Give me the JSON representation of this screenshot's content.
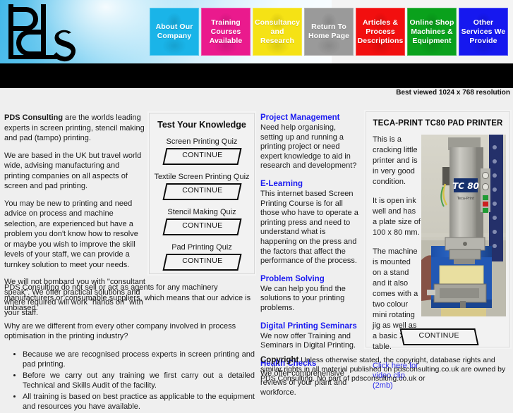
{
  "header": {
    "logo_text": "pds",
    "best_viewed": "Best viewed 1024 x 768 resolution",
    "nav": [
      {
        "label": "About Our Company",
        "color": "#1ab4e8",
        "class": "b-cyan",
        "name": "nav-about-our-company"
      },
      {
        "label": "Training Courses Available",
        "color": "#ea1a8d",
        "class": "b-magenta",
        "name": "nav-training-courses-available"
      },
      {
        "label": "Consultancy and Research",
        "color": "#f5e215",
        "class": "b-yellow",
        "name": "nav-consultancy-and-research"
      },
      {
        "label": "Return To Home Page",
        "color": "#9a9a9a",
        "class": "b-gray",
        "name": "nav-return-to-home-page"
      },
      {
        "label": "Articles & Process Descriptions",
        "color": "#f20f0f",
        "class": "b-red",
        "name": "nav-articles-process-descriptions"
      },
      {
        "label": "Online Shop Machines & Equipment",
        "color": "#0aa11c",
        "class": "b-green",
        "name": "nav-online-shop-machines-equipment"
      },
      {
        "label": "Other Services We Provide",
        "color": "#1618ef",
        "class": "b-blue",
        "name": "nav-other-services-we-provide"
      }
    ]
  },
  "left_column": {
    "lead_bold": "PDS Consulting",
    "p1_rest": " are the worlds leading experts in screen printing, stencil making and pad (tampo) printing.",
    "p2": "We are based in the UK but travel world wide, advising manufacturing and printing companies on all aspects of screen and pad printing.",
    "p3": "You may be new to printing and need advice on process and machine selection, are experienced but have a problem you don't know how to resolve or maybe you wish to improve the skill levels of your staff, we can provide a turnkey solution to meet your needs.",
    "p4": "We will not bombard you with \"consultant speak\". We offer practical solutions and where required will work \"hands on\" with your staff."
  },
  "lower_section": {
    "p1": "PDS Consulting do not sell or act as agents for any machinery manufacturers or consumable suppliers, which means that our advice is unbiased.",
    "p2": "Why are we different from every other company involved in process optimisation in the printing industry?",
    "bullets": [
      "Because we are recognised process experts in screen printing and pad printing.",
      "Before we carry out any training we first carry out a detailed Technical and Skills Audit of the facility.",
      "All training is based on best practice as applicable to the equipment and resources you have available."
    ]
  },
  "quiz_panel": {
    "title": "Test Your Knowledge",
    "continue_label": "CONTINUE",
    "items": [
      {
        "label": "Screen Printing Quiz",
        "name": "quiz-screen-printing"
      },
      {
        "label": "Textile Screen Printing Quiz",
        "name": "quiz-textile-screen-printing"
      },
      {
        "label": "Stencil Making Quiz",
        "name": "quiz-stencil-making"
      },
      {
        "label": "Pad Printing Quiz",
        "name": "quiz-pad-printing"
      }
    ]
  },
  "services": [
    {
      "heading": "Project Management",
      "body": "Need help organising, setting up and running a printing project or need expert knowledge to aid in research and development?",
      "name": "service-project-management"
    },
    {
      "heading": "E-Learning",
      "body": "This internet based Screen Printing Course is for all those who have to operate a printing press and need to understand what is happening on the press and the factors that affect the performance of the process.",
      "name": "service-e-learning"
    },
    {
      "heading": "Problem Solving",
      "body": "We can help you find the solutions to your printing problems.",
      "name": "service-problem-solving"
    },
    {
      "heading": "Digital Printing Seminars",
      "body": "We now offer Training and Seminars in Digital Printing.",
      "name": "service-digital-printing-seminars"
    },
    {
      "heading": "Health Checks",
      "body": "We offer comprehensive reviews of your plant and workforce.",
      "name": "service-health-checks"
    }
  ],
  "product_panel": {
    "title": "TECA-PRINT TC80 PAD PRINTER",
    "p1": "This is a cracking little printer and is in very good condition.",
    "p2": "It is open ink well and has a plate size of 100 x 80 mm.",
    "p3": "The machine is mounted on a stand and it also comes with a two colour mini rotating jig as well as a basic XY table.",
    "video_link": "Click here for video clip (2mb)",
    "continue_label": "CONTINUE",
    "photo_label": "TC 80",
    "photo_sublabel": "Teca-Print"
  },
  "copyright": {
    "bold": "Copyright",
    "text": " Unless otherwise stated, the copyright, database rights and similar rights in all material published on pdsconsulting.co.uk are owned by PDS Consulting. No part of pdsconsulting.co.uk or"
  }
}
